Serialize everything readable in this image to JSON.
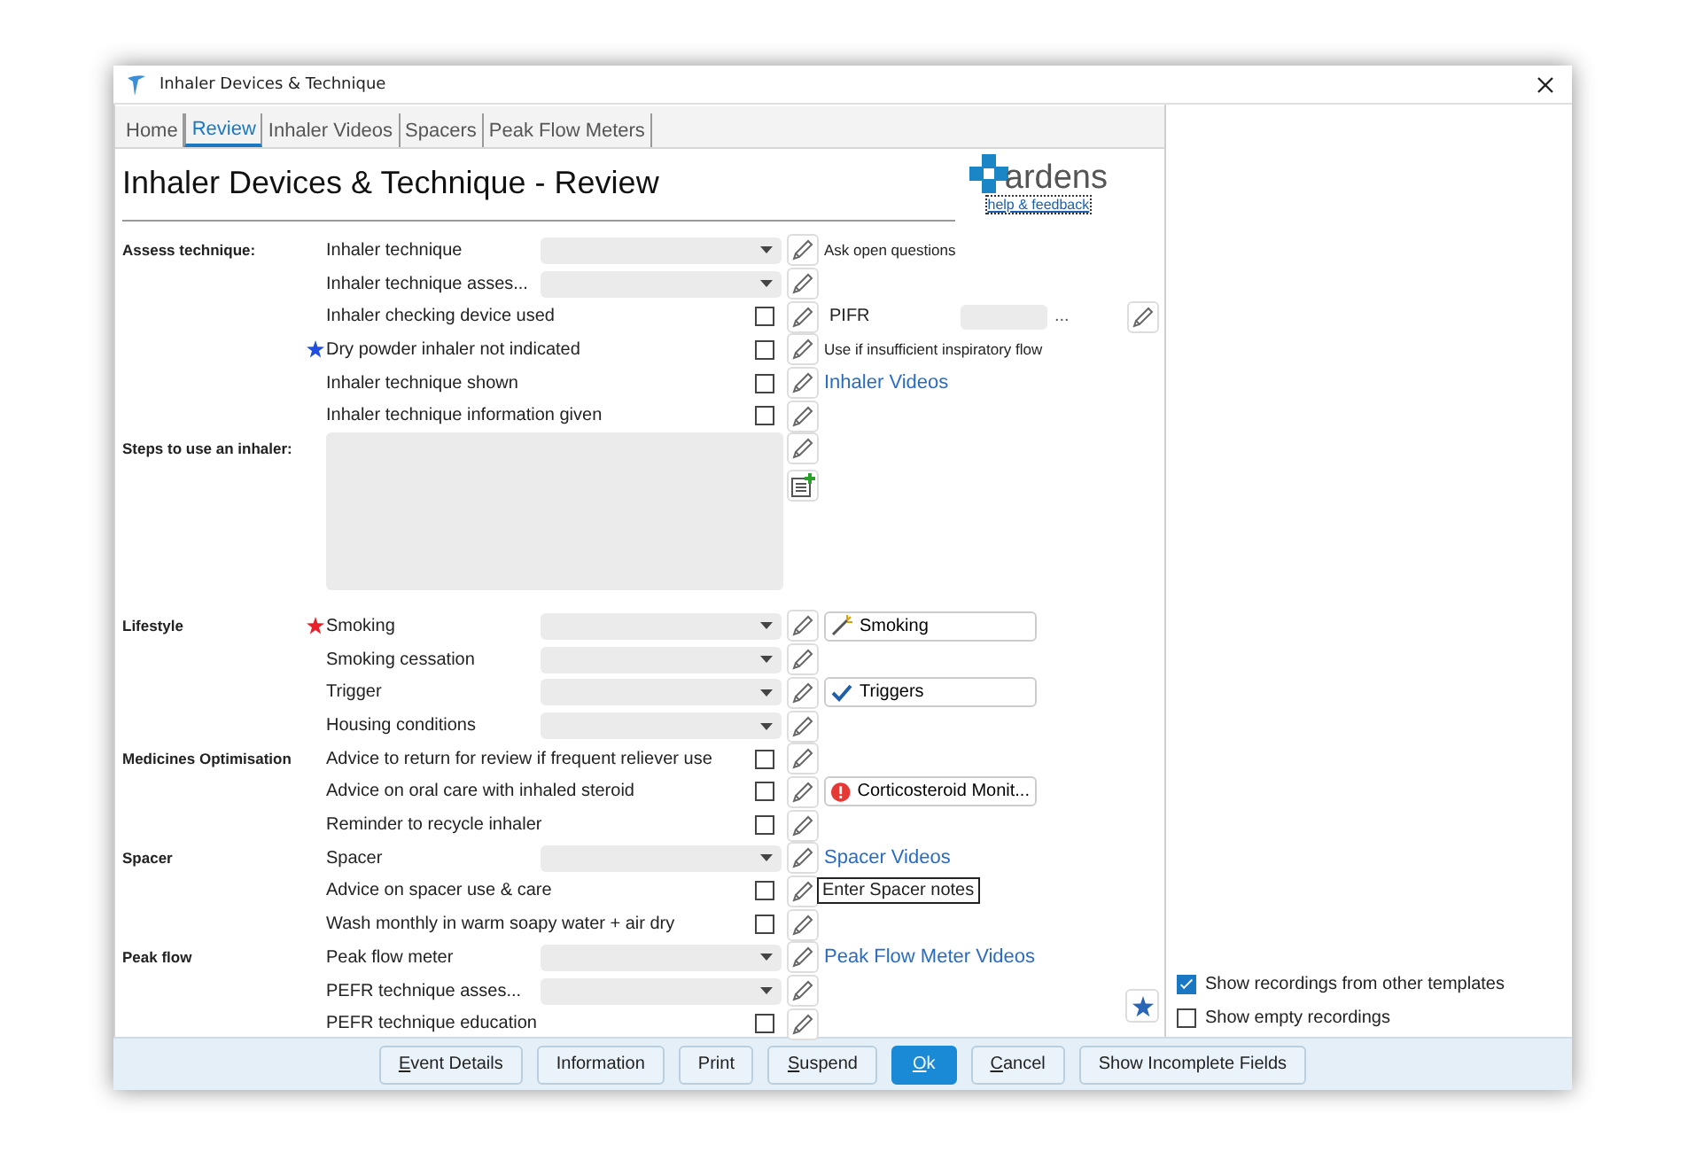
{
  "window": {
    "title": "Inhaler Devices & Technique"
  },
  "tabs": [
    {
      "label": "Home",
      "selected": false
    },
    {
      "label": "Review",
      "selected": true
    },
    {
      "label": "Inhaler Videos",
      "selected": false
    },
    {
      "label": "Spacers",
      "selected": false
    },
    {
      "label": "Peak Flow Meters",
      "selected": false
    }
  ],
  "heading": "Inhaler Devices & Technique - Review",
  "logo": {
    "name": "ardens",
    "link": "help & feedback"
  },
  "sections": [
    {
      "title": "Assess technique:",
      "rows": [
        {
          "kind": "dropdown",
          "label": "Inhaler technique",
          "required": false,
          "recommended": false,
          "extra": {
            "kind": "note",
            "text": "Ask open questions"
          }
        },
        {
          "kind": "dropdown",
          "label": "Inhaler technique asses...",
          "required": false,
          "recommended": false
        },
        {
          "kind": "checkbox",
          "label": "Inhaler checking device used",
          "checked": false,
          "required": false,
          "recommended": false,
          "extra": {
            "kind": "pifr",
            "text": "PIFR",
            "more": "..."
          }
        },
        {
          "kind": "checkbox",
          "label": "Dry powder inhaler not indicated",
          "checked": false,
          "required": false,
          "recommended": true,
          "extra": {
            "kind": "note",
            "text": "Use if insufficient inspiratory flow"
          }
        },
        {
          "kind": "checkbox",
          "label": "Inhaler technique shown",
          "checked": false,
          "required": false,
          "recommended": false,
          "extra": {
            "kind": "link",
            "text": "Inhaler Videos"
          }
        },
        {
          "kind": "checkbox",
          "label": "Inhaler technique information given",
          "checked": false,
          "required": false,
          "recommended": false
        }
      ]
    },
    {
      "title": "Steps to use an inhaler:",
      "rows": [
        {
          "kind": "textarea",
          "required": false,
          "recommended": false
        }
      ]
    },
    {
      "title": "Lifestyle",
      "rows": [
        {
          "kind": "dropdown",
          "label": "Smoking",
          "required": true,
          "recommended": false,
          "extra": {
            "kind": "action",
            "text": "Smoking"
          }
        },
        {
          "kind": "dropdown",
          "label": "Smoking cessation",
          "required": false,
          "recommended": false
        },
        {
          "kind": "dropdown",
          "label": "Trigger",
          "required": false,
          "recommended": false,
          "extra": {
            "kind": "done",
            "text": "Triggers"
          }
        },
        {
          "kind": "dropdown",
          "label": "Housing conditions",
          "required": false,
          "recommended": false
        }
      ]
    },
    {
      "title": "Medicines Optimisation",
      "rows": [
        {
          "kind": "checkbox",
          "label": "Advice to return for review if frequent reliever use",
          "checked": false,
          "required": false,
          "recommended": false
        },
        {
          "kind": "checkbox",
          "label": "Advice on oral care with inhaled steroid",
          "checked": false,
          "required": false,
          "recommended": false,
          "extra": {
            "kind": "warning",
            "text": "Corticosteroid Monit..."
          }
        },
        {
          "kind": "checkbox",
          "label": "Reminder to recycle inhaler",
          "checked": false,
          "required": false,
          "recommended": false
        }
      ]
    },
    {
      "title": "Spacer",
      "rows": [
        {
          "kind": "dropdown",
          "label": "Spacer",
          "required": false,
          "recommended": false,
          "extra": {
            "kind": "link",
            "text": "Spacer Videos"
          }
        },
        {
          "kind": "checkbox",
          "label": "Advice on spacer use & care",
          "checked": false,
          "required": false,
          "recommended": false,
          "extra": {
            "kind": "tooltip",
            "text": "Enter Spacer notes"
          }
        },
        {
          "kind": "checkbox",
          "label": "Wash monthly in warm soapy water + air dry",
          "checked": false,
          "required": false,
          "recommended": false
        }
      ]
    },
    {
      "title": "Peak flow",
      "rows": [
        {
          "kind": "dropdown",
          "label": "Peak flow meter",
          "required": false,
          "recommended": false,
          "extra": {
            "kind": "link",
            "text": "Peak Flow Meter Videos"
          }
        },
        {
          "kind": "dropdown",
          "label": "PEFR technique asses...",
          "required": false,
          "recommended": false
        },
        {
          "kind": "checkbox",
          "label": "PEFR technique education",
          "checked": false,
          "required": false,
          "recommended": false
        }
      ]
    }
  ],
  "options": [
    {
      "label": "Show recordings from other templates",
      "checked": true
    },
    {
      "label": "Show empty recordings",
      "checked": false
    }
  ],
  "buttons": [
    {
      "label": "Event Details",
      "access_key": true,
      "primary": false
    },
    {
      "label": "Information",
      "access_key": false,
      "primary": false
    },
    {
      "label": "Print",
      "access_key": false,
      "primary": false
    },
    {
      "label": "Suspend",
      "access_key": true,
      "primary": false
    },
    {
      "label": "Ok",
      "access_key": true,
      "primary": true
    },
    {
      "label": "Cancel",
      "access_key": true,
      "primary": false
    },
    {
      "label": "Show Incomplete Fields",
      "access_key": false,
      "primary": false
    }
  ]
}
